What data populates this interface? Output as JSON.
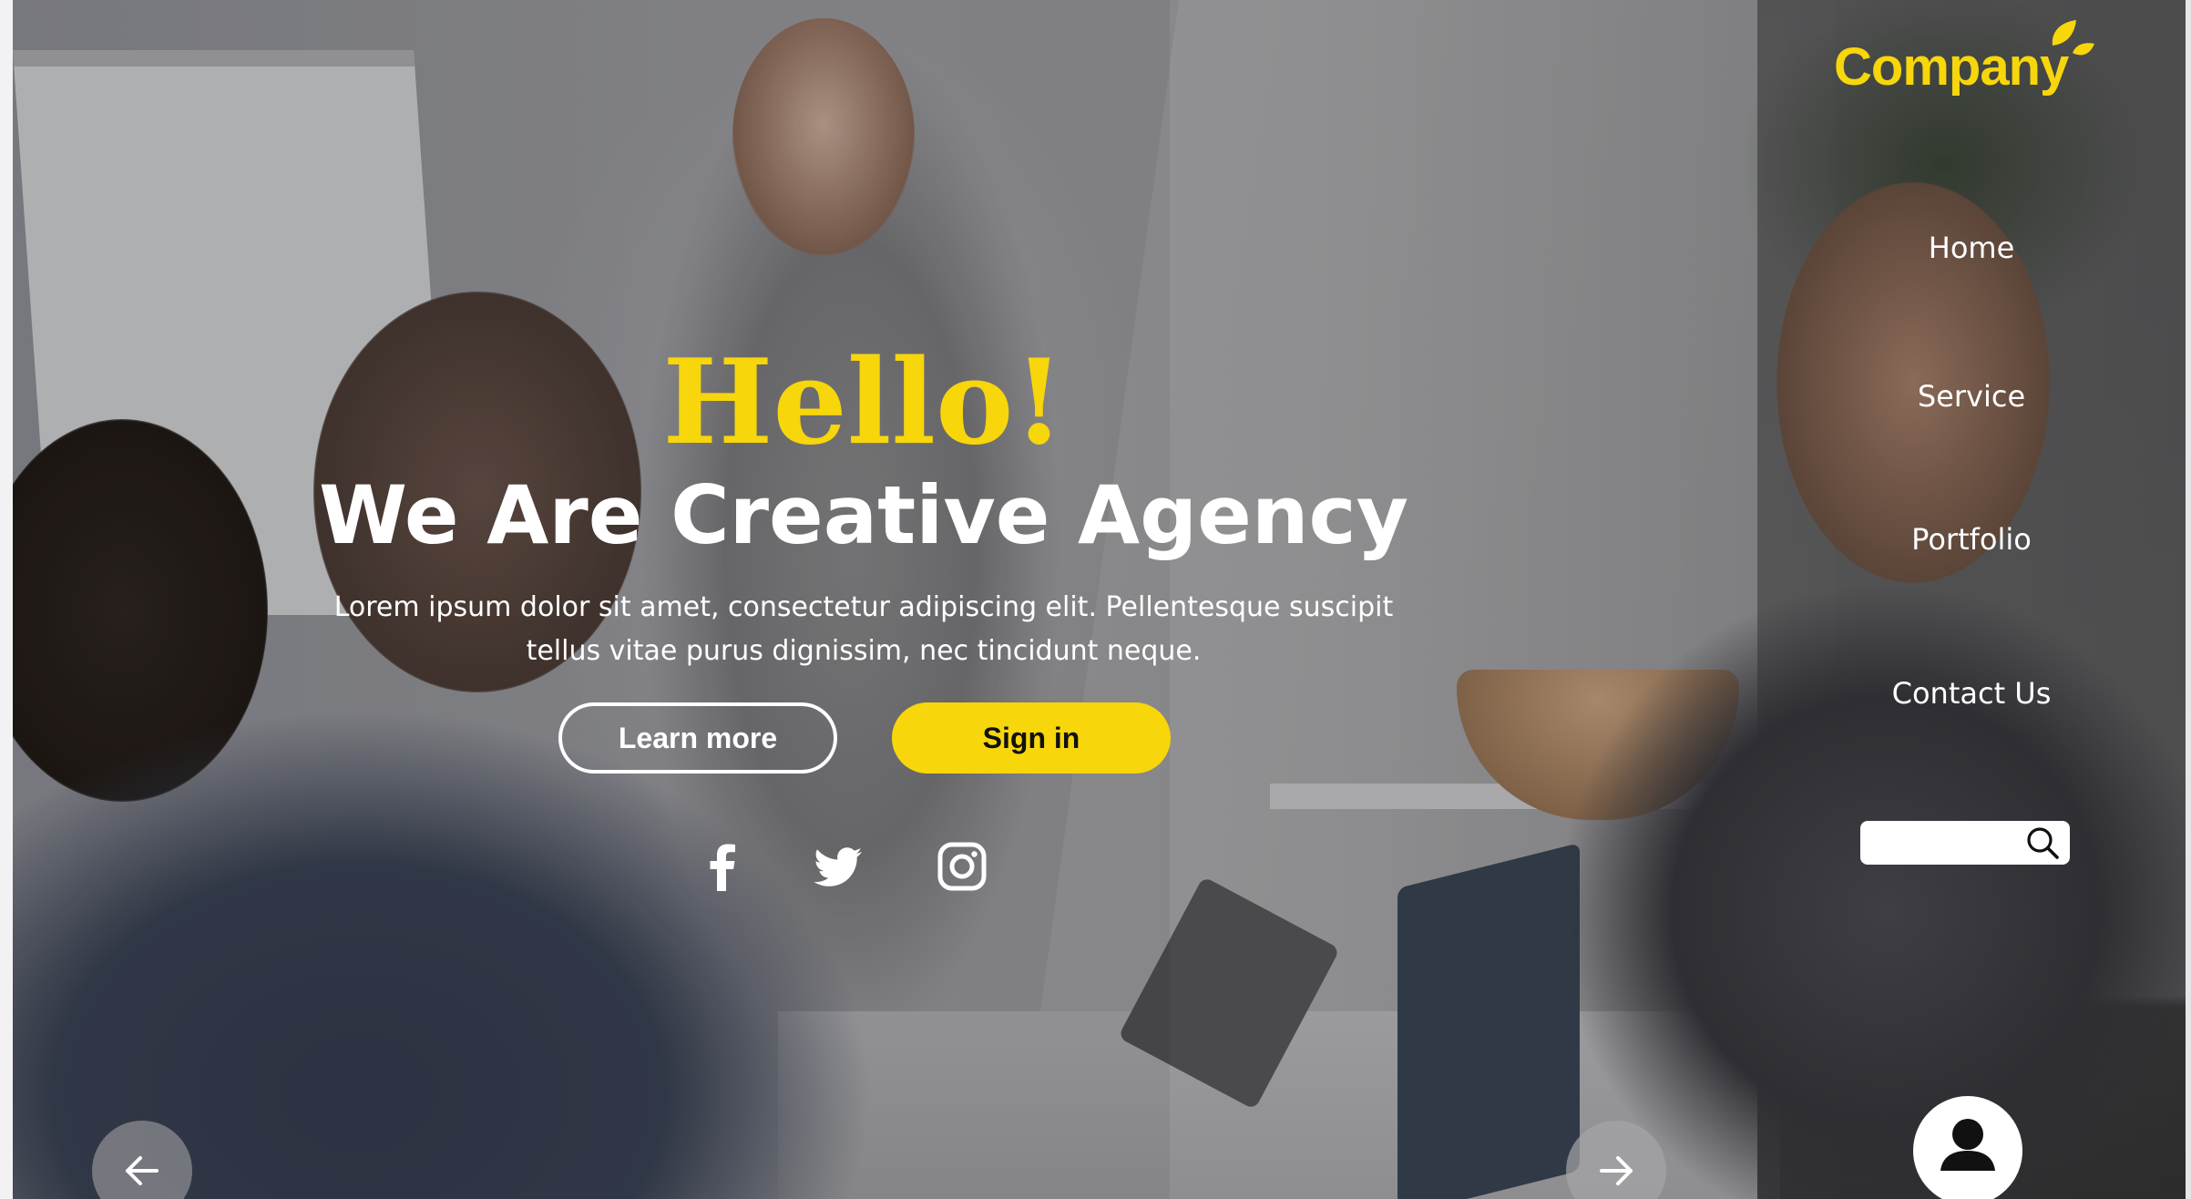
{
  "brand": {
    "name": "Company",
    "color": "#f7d60b"
  },
  "nav": {
    "items": [
      {
        "label": "Home"
      },
      {
        "label": "Service"
      },
      {
        "label": "Portfolio"
      },
      {
        "label": "Contact Us"
      }
    ]
  },
  "search": {
    "value": "",
    "placeholder": "",
    "icon": "search-icon"
  },
  "hero": {
    "greeting": "Hello!",
    "headline": "We Are Creative Agency",
    "tagline_line1": "Lorem ipsum dolor sit amet, consectetur adipiscing elit. Pellentesque suscipit",
    "tagline_line2": "tellus vitae purus dignissim, nec tincidunt neque."
  },
  "buttons": {
    "learn_more": "Learn more",
    "sign_in": "Sign in"
  },
  "social": [
    {
      "icon": "facebook-icon"
    },
    {
      "icon": "twitter-icon"
    },
    {
      "icon": "instagram-icon"
    }
  ],
  "carousel": {
    "prev_icon": "arrow-left-icon",
    "next_icon": "arrow-right-icon"
  },
  "user": {
    "icon": "user-avatar-icon"
  },
  "colors": {
    "accent": "#f7d60b",
    "text": "#ffffff",
    "sidebar_overlay": "rgba(40,40,40,0.5)"
  }
}
